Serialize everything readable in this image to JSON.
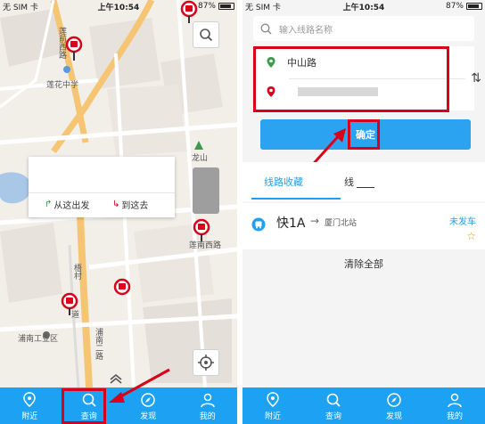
{
  "status_bar": {
    "carrier": "无 SIM 卡",
    "time": "上午10:54",
    "battery": "87%"
  },
  "map": {
    "labels": [
      "莲花中学",
      "龙山",
      "莲南西路",
      "浦南工业区",
      "浦南二路",
      "莲前西路",
      "梧村",
      "道"
    ],
    "popup": {
      "depart_label": "从这出发",
      "arrive_label": "到这去"
    }
  },
  "tabbar": {
    "items": [
      {
        "label": "附近",
        "icon": "location-pin-icon"
      },
      {
        "label": "查询",
        "icon": "search-icon"
      },
      {
        "label": "发现",
        "icon": "compass-icon"
      },
      {
        "label": "我的",
        "icon": "person-icon"
      }
    ]
  },
  "query": {
    "search_placeholder": "输入线路名称",
    "start": "中山路",
    "end": "",
    "swap_icon": "⇅",
    "confirm_label": "确定",
    "tabs": [
      "线路收藏",
      "线"
    ],
    "favorite": {
      "line": "快1A",
      "destination": "厦门北站",
      "status": "未发车"
    },
    "clear_all": "清除全部"
  },
  "colors": {
    "accent": "#1da1f2",
    "highlight_red": "#d9001b",
    "map_bg": "#f2efe9"
  }
}
